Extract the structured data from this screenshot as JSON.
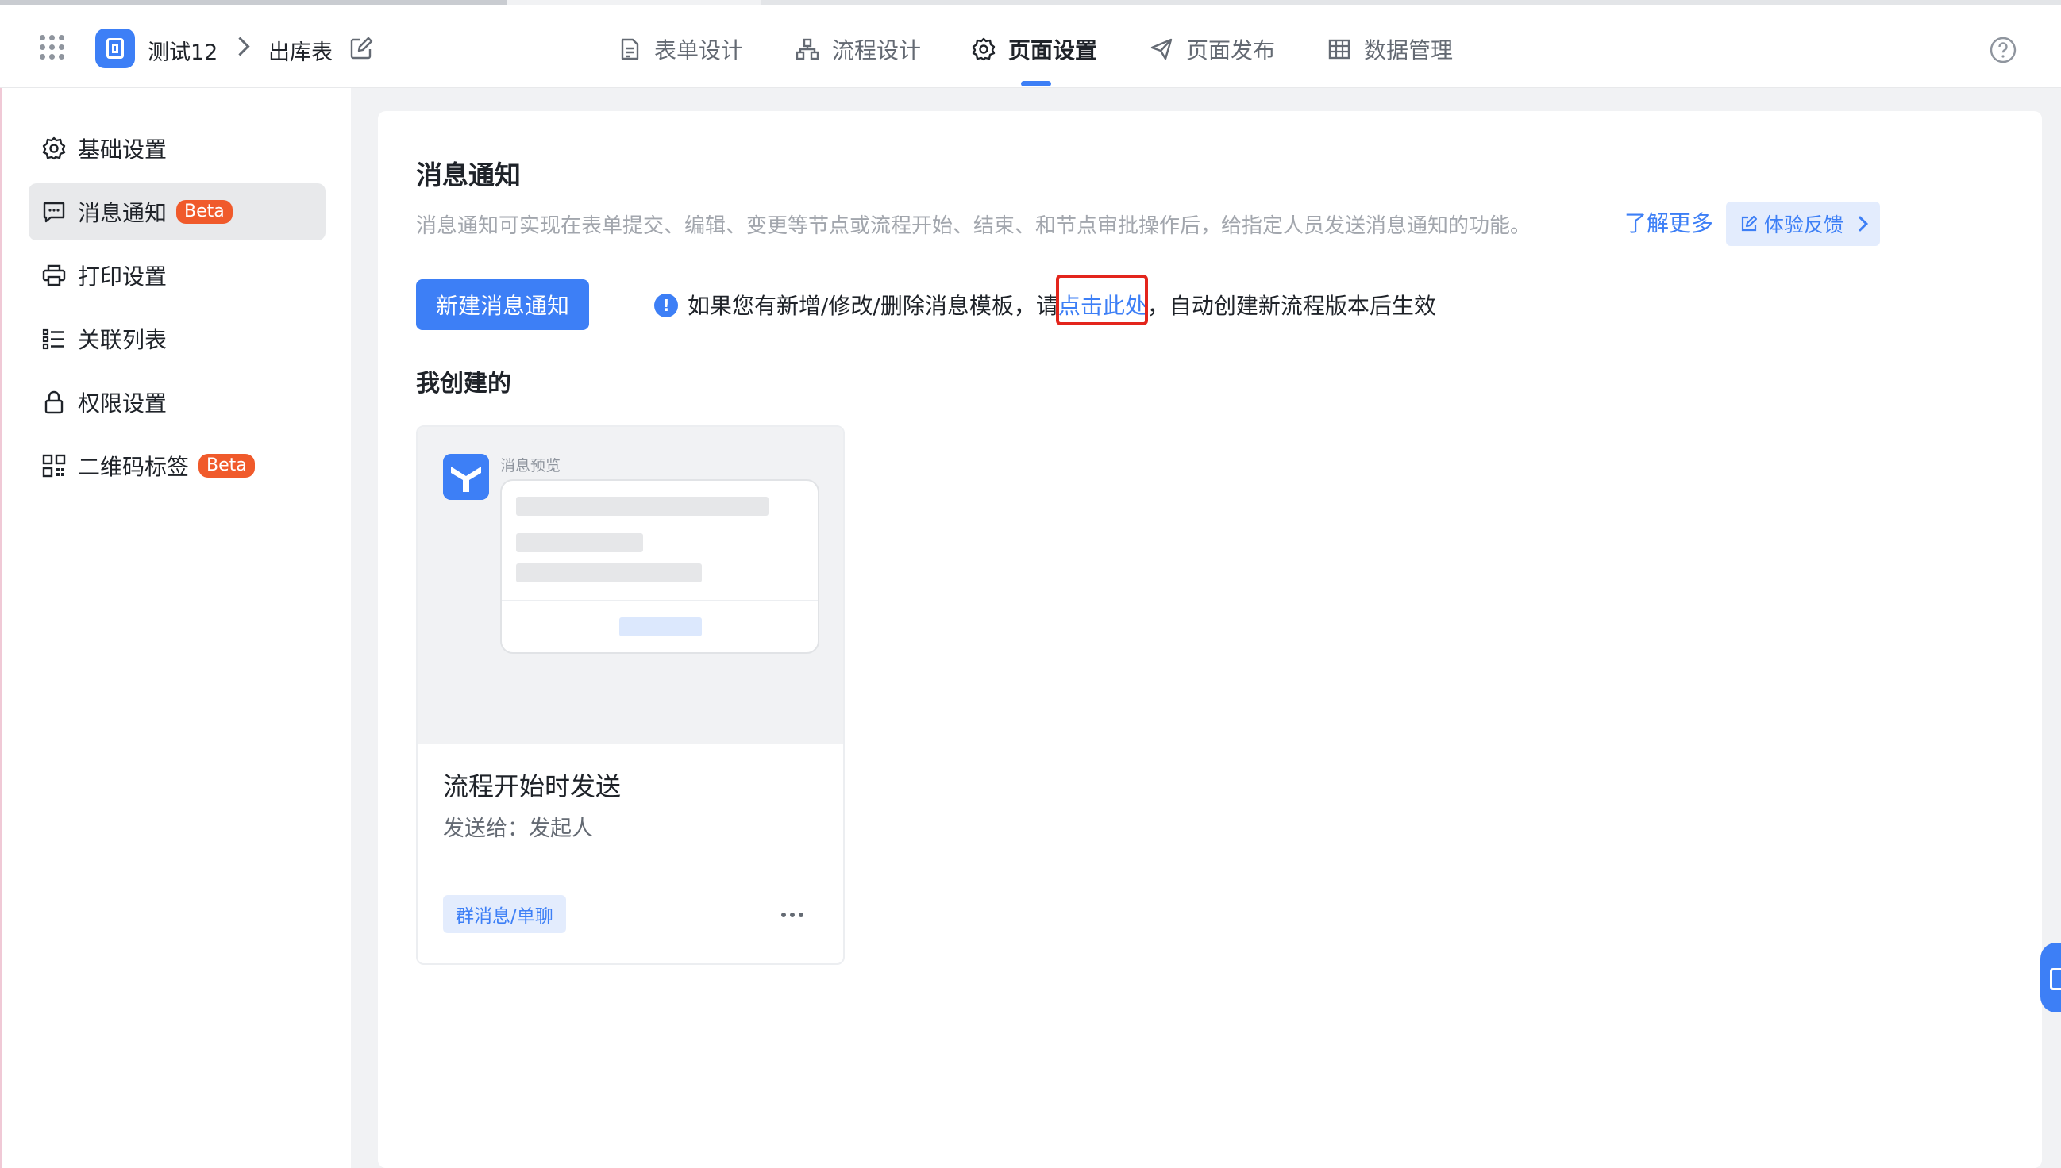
{
  "header": {
    "app_name": "测试12",
    "form_name": "出库表",
    "tabs": [
      {
        "label": "表单设计",
        "icon": "document-icon"
      },
      {
        "label": "流程设计",
        "icon": "flow-icon"
      },
      {
        "label": "页面设置",
        "icon": "gear-icon",
        "active": true
      },
      {
        "label": "页面发布",
        "icon": "send-icon"
      },
      {
        "label": "数据管理",
        "icon": "table-icon"
      }
    ]
  },
  "sidebar": {
    "items": [
      {
        "label": "基础设置",
        "icon": "gear-icon"
      },
      {
        "label": "消息通知",
        "icon": "message-icon",
        "badge": "Beta",
        "active": true
      },
      {
        "label": "打印设置",
        "icon": "printer-icon"
      },
      {
        "label": "关联列表",
        "icon": "list-icon"
      },
      {
        "label": "权限设置",
        "icon": "lock-icon"
      },
      {
        "label": "二维码标签",
        "icon": "qrcode-icon",
        "badge": "Beta"
      }
    ]
  },
  "main": {
    "title": "消息通知",
    "description": "消息通知可实现在表单提交、编辑、变更等节点或流程开始、结束、和节点审批操作后，给指定人员发送消息通知的功能。",
    "learn_more": "了解更多",
    "feedback": "体验反馈",
    "new_button": "新建消息通知",
    "tip": {
      "before": "如果您有新增/修改/删除消息模板，请",
      "link": "点击此处",
      "after": "，自动创建新流程版本后生效"
    },
    "section_title": "我创建的",
    "card": {
      "preview_title": "消息预览",
      "title": "流程开始时发送",
      "send_to": "发送给：发起人",
      "tag": "群消息/单聊"
    }
  },
  "colors": {
    "accent": "#3d7ff6",
    "beta_badge": "#f05a2b",
    "highlight_box": "#e3251c"
  }
}
